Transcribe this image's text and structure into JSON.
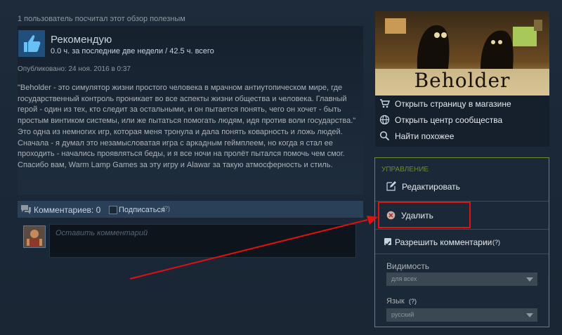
{
  "review": {
    "helpful_count_text": "1 пользователь посчитал этот обзор полезным",
    "recommend_label": "Рекомендую",
    "hours_text": "0.0 ч. за последние две недели / 42.5 ч. всего",
    "posted_text": "Опубликовано: 24 ноя. 2016 в 0:37",
    "body": "\"Beholder - это симулятор жизни простого человека в мрачном антиутопическом мире, где\nгосударственный контроль проникает во все аспекты жизни общества и человека. Главный\nгерой - один из тех, кто следит за остальными, и он пытается понять, чего он хочет - быть\nпростым винтиком системы, или же пытаться помогать людям, идя против воли государства.\"\nЭто одна из немногих игр, которая меня тронула и дала понять коварность и ложь людей.\nСначала - я думал это незамысловатая игра с аркадным геймплеем, но когда я стал ее\nпроходить - начались проявляться беды, и я все ночи на пролёт пытался помочь чем смог.\nСпасибо вам, Warm Lamp Games за эту игру и Alawar за такую атмосферность и стиль."
  },
  "comments": {
    "label": "Комментариев: 0",
    "subscribe_label": "Подписаться",
    "subscribe_help": "(?)",
    "input_placeholder": "Оставить комментарий"
  },
  "game": {
    "title": "Beholder",
    "links": [
      {
        "label": "Открыть страницу в магазине",
        "icon": "cart-icon"
      },
      {
        "label": "Открыть центр сообщества",
        "icon": "globe-icon"
      },
      {
        "label": "Найти похожее",
        "icon": "search-icon"
      }
    ]
  },
  "manage": {
    "title": "УПРАВЛЕНИЕ",
    "edit_label": "Редактировать",
    "delete_label": "Удалить",
    "allow_comments_label": "Разрешить комментарии",
    "allow_comments_help": "(?)",
    "allow_comments_checked": true,
    "visibility_label": "Видимость",
    "visibility_value": "для всех",
    "language_label": "Язык",
    "language_help": "(?)",
    "language_value": "русский"
  },
  "colors": {
    "background": "#1b2838",
    "accent_green": "#6d8c2c",
    "highlight_red": "#e01111"
  }
}
